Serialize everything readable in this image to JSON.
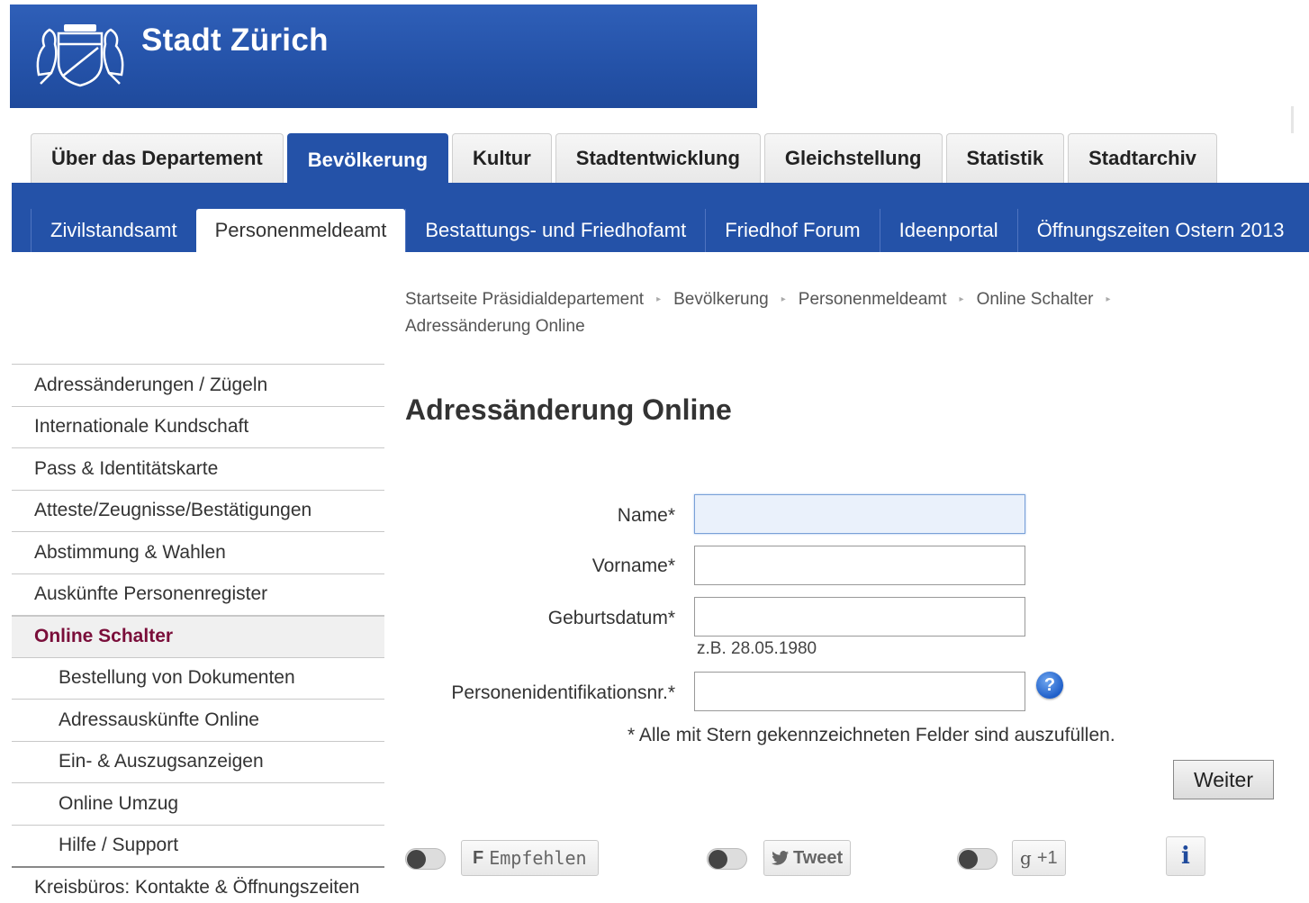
{
  "header": {
    "title": "Stadt Zürich",
    "logo_icon": "zurich-coat-of-arms",
    "banner_color": "#2452a8"
  },
  "main_tabs": [
    {
      "label": "Über das Departement",
      "active": false
    },
    {
      "label": "Bevölkerung",
      "active": true
    },
    {
      "label": "Kultur",
      "active": false
    },
    {
      "label": "Stadtentwicklung",
      "active": false
    },
    {
      "label": "Gleichstellung",
      "active": false
    },
    {
      "label": "Statistik",
      "active": false
    },
    {
      "label": "Stadtarchiv",
      "active": false
    }
  ],
  "sub_tabs": [
    {
      "label": "Zivilstandsamt",
      "active": false
    },
    {
      "label": "Personenmeldeamt",
      "active": true
    },
    {
      "label": "Bestattungs- und Friedhofamt",
      "active": false
    },
    {
      "label": "Friedhof Forum",
      "active": false
    },
    {
      "label": "Ideenportal",
      "active": false
    },
    {
      "label": "Öffnungszeiten Ostern 2013",
      "active": false
    }
  ],
  "breadcrumb": {
    "items": [
      "Startseite Präsidialdepartement",
      "Bevölkerung",
      "Personenmeldeamt",
      "Online Schalter"
    ],
    "current": "Adressänderung Online",
    "separator": "▸"
  },
  "sidebar": {
    "items": [
      {
        "label": "Adressänderungen / Zügeln",
        "level": 1
      },
      {
        "label": "Internationale Kundschaft",
        "level": 1
      },
      {
        "label": "Pass & Identitätskarte",
        "level": 1
      },
      {
        "label": "Atteste/Zeugnisse/Bestätigungen",
        "level": 1
      },
      {
        "label": "Abstimmung & Wahlen",
        "level": 1
      },
      {
        "label": "Auskünfte Personenregister",
        "level": 1
      },
      {
        "label": "Online Schalter",
        "level": 1,
        "active": true
      },
      {
        "label": "Bestellung von Dokumenten",
        "level": 2
      },
      {
        "label": "Adressauskünfte Online",
        "level": 2
      },
      {
        "label": "Ein- & Auszugsanzeigen",
        "level": 2
      },
      {
        "label": "Online Umzug",
        "level": 2
      },
      {
        "label": "Hilfe / Support",
        "level": 2
      },
      {
        "label": "Kreisbüros: Kontakte & Öffnungszeiten",
        "level": 1
      }
    ],
    "active_color": "#7a0e3a"
  },
  "page": {
    "title": "Adressänderung Online"
  },
  "form": {
    "name_label": "Name*",
    "name_value": "",
    "vorname_label": "Vorname*",
    "vorname_value": "",
    "geburtsdatum_label": "Geburtsdatum*",
    "geburtsdatum_value": "",
    "geburtsdatum_hint": "z.B. 28.05.1980",
    "pid_label": "Personenidentifikationsnr.*",
    "pid_value": "",
    "help_icon": "question-icon",
    "help_glyph": "?",
    "required_note": "* Alle mit Stern gekennzeichneten Felder sind auszufüllen.",
    "submit_label": "Weiter"
  },
  "social": {
    "facebook_glyph": "F",
    "facebook_label": "Empfehlen",
    "twitter_glyph": "🐦",
    "twitter_label": "Tweet",
    "google_glyph": "g",
    "google_label": "+1",
    "info_glyph": "i"
  }
}
